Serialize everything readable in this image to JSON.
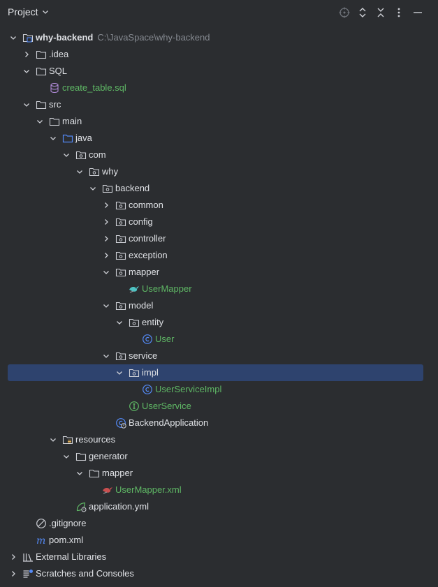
{
  "header": {
    "title": "Project",
    "icons": [
      "locate-icon",
      "expand-collapse-icon",
      "collapse-all-icon",
      "more-options-icon",
      "minimize-icon"
    ]
  },
  "tree": {
    "root": {
      "label": "why-backend",
      "path": "C:\\JavaSpace\\why-backend"
    },
    "idea": ".idea",
    "sql": "SQL",
    "create_table": "create_table.sql",
    "src": "src",
    "main": "main",
    "java": "java",
    "com": "com",
    "why": "why",
    "backend": "backend",
    "common": "common",
    "config": "config",
    "controller": "controller",
    "exception": "exception",
    "mapper": "mapper",
    "user_mapper": "UserMapper",
    "model": "model",
    "entity": "entity",
    "user": "User",
    "service": "service",
    "impl": "impl",
    "user_service_impl": "UserServiceImpl",
    "user_service": "UserService",
    "backend_application": "BackendApplication",
    "resources": "resources",
    "generator": "generator",
    "gen_mapper": "mapper",
    "user_mapper_xml": "UserMapper.xml",
    "application_yml": "application.yml",
    "gitignore": ".gitignore",
    "pom": "pom.xml",
    "external_libraries": "External Libraries",
    "scratches": "Scratches and Consoles"
  },
  "colors": {
    "background": "#2b2d30",
    "selection": "#2e436e",
    "text": "#dfe1e5",
    "modified_green": "#5fb865",
    "path_gray": "#868a91",
    "class_blue": "#548af7"
  }
}
